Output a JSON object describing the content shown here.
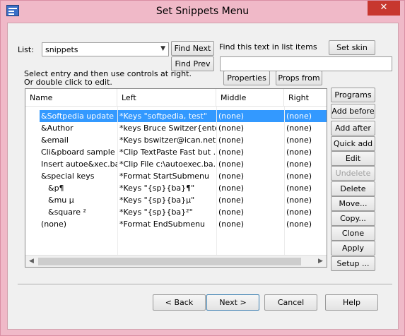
{
  "window": {
    "title": "Set Snippets Menu",
    "close_glyph": "✕"
  },
  "top": {
    "list_label": "List:",
    "list_value": "snippets",
    "find_next": "Find Next",
    "find_prev": "Find Prev",
    "find_label": "Find this text in list items",
    "set_skin": "Set skin",
    "properties": "Properties ...",
    "props_from": "Props from ...",
    "instruction_1": "Select entry and then use controls at right.",
    "instruction_2": "Or double click to edit."
  },
  "table": {
    "columns": [
      "Name",
      "Left",
      "Middle",
      "Right"
    ],
    "rows": [
      {
        "name": "&Softpedia update",
        "left": "*Keys \"softpedia, test\"",
        "middle": "(none)",
        "right": "(none)",
        "selected": true
      },
      {
        "name": "&Author",
        "left": "*keys Bruce Switzer{ente...",
        "middle": "(none)",
        "right": "(none)"
      },
      {
        "name": "&email",
        "left": "*Keys bswitzer@ican.net",
        "middle": "(none)",
        "right": "(none)"
      },
      {
        "name": "Cli&pboard sample",
        "left": "*Clip TextPaste Fast but ...",
        "middle": "(none)",
        "right": "(none)"
      },
      {
        "name": "Insert autoe&xec.bat",
        "left": "*Clip File  c:\\autoexec.ba...",
        "middle": "(none)",
        "right": "(none)"
      },
      {
        "name": "&special keys",
        "left": "*Format StartSubmenu",
        "middle": "(none)",
        "right": "(none)"
      },
      {
        "name": "&p¶",
        "left": "*Keys  \"{sp}{ba}¶\"",
        "middle": "(none)",
        "right": "(none)",
        "indent": true
      },
      {
        "name": "&mu µ",
        "left": "*Keys  \"{sp}{ba}µ\"",
        "middle": "(none)",
        "right": "(none)",
        "indent": true
      },
      {
        "name": "&square ²",
        "left": "*Keys  \"{sp}{ba}²\"",
        "middle": "(none)",
        "right": "(none)",
        "indent": true
      },
      {
        "name": "(none)",
        "left": "*Format EndSubmenu",
        "middle": "(none)",
        "right": "(none)"
      }
    ]
  },
  "side_buttons": {
    "programs": "Programs",
    "add_before": "Add before",
    "add_after": "Add after",
    "quick_add": "Quick add",
    "edit": "Edit",
    "undelete": "Undelete",
    "delete": "Delete",
    "move": "Move...",
    "copy": "Copy...",
    "clone": "Clone",
    "apply": "Apply",
    "setup": "Setup ..."
  },
  "bottom": {
    "back": "< Back",
    "next": "Next >",
    "cancel": "Cancel",
    "help": "Help"
  }
}
